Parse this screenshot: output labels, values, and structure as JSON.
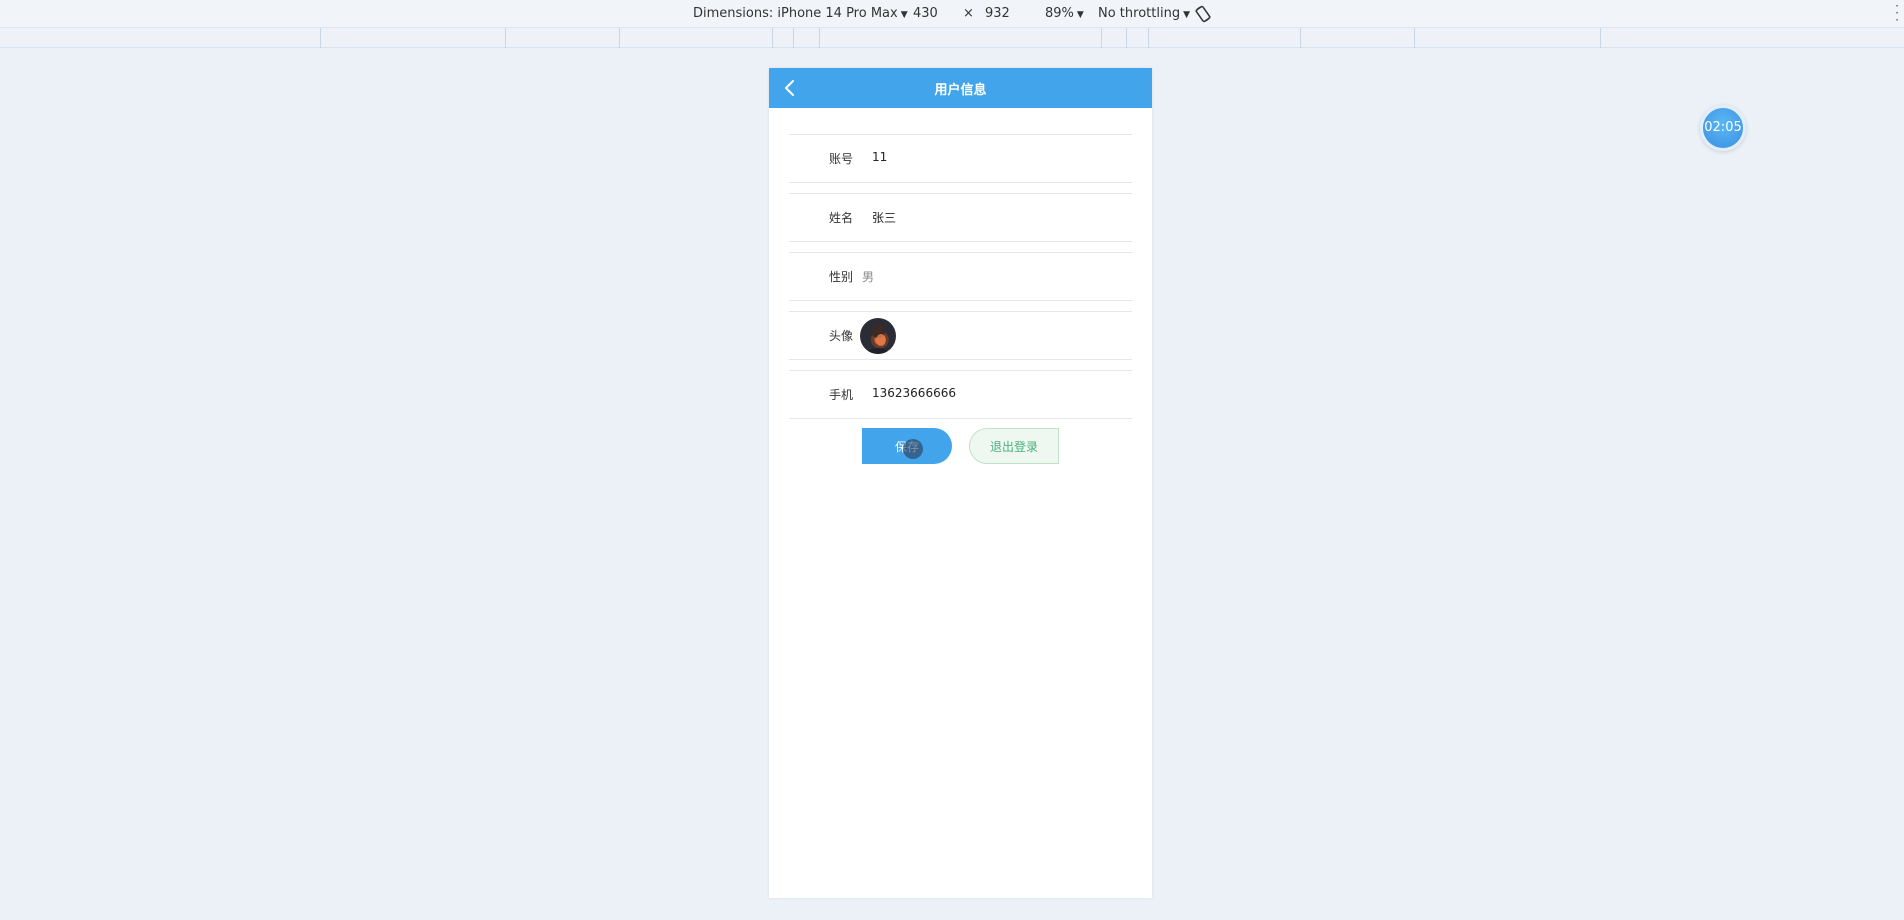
{
  "devtools": {
    "dimensions_label": "Dimensions: iPhone 14 Pro Max",
    "width": "430",
    "times": "×",
    "height": "932",
    "zoom": "89%",
    "throttling": "No throttling",
    "dropdown_glyph": "▼",
    "rotate_icon": "rotate-icon"
  },
  "app": {
    "title": "用户信息",
    "back_icon": "chevron-left-icon",
    "fields": [
      {
        "label": "账号",
        "value": "11"
      },
      {
        "label": "姓名",
        "value": "张三"
      },
      {
        "label": "性别",
        "value": "男"
      },
      {
        "label": "头像",
        "value": ""
      },
      {
        "label": "手机",
        "value": "13623666666"
      }
    ],
    "save_label": "保存",
    "logout_label": "退出登录"
  },
  "timer": {
    "value": "02:05"
  },
  "colors": {
    "primary": "#42a5ec",
    "logout_text": "#4caf7d",
    "page_bg": "#ecf1f8"
  }
}
